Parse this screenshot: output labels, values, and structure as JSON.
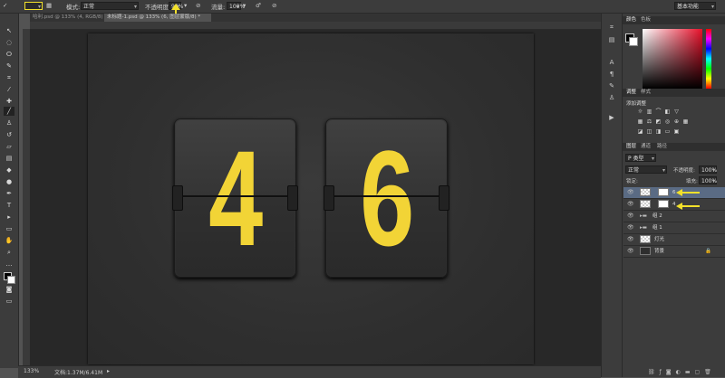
{
  "options_bar": {
    "mode_label": "模式:",
    "mode_value": "正常",
    "opacity_label": "不透明度:",
    "opacity_value": "90%",
    "flow_label": "流量:",
    "flow_value": "100%",
    "workspace": "基本功能"
  },
  "tabs": [
    {
      "label": "哈利.psd @ 133% (4, RGB/8) *"
    },
    {
      "label": "未标题-1.psd @ 133% (6, 图层蒙版/8) *"
    }
  ],
  "canvas": {
    "digit_left": "4",
    "digit_right": "6",
    "digit_color": "#f2d436",
    "highlight_color": "#f3e12a"
  },
  "status": {
    "zoom": "133%",
    "doc_info": "文档:1.37M/6.41M"
  },
  "panels": {
    "color_tabs": [
      "颜色",
      "色板"
    ],
    "adjust_tabs": [
      "调整",
      "样式"
    ],
    "adjust_title": "添加调整",
    "layer_tabs": [
      "图层",
      "通道",
      "路径"
    ],
    "filter_label": "P 类型",
    "blend_mode": "正常",
    "opacity_label": "不透明度:",
    "opacity_value": "100%",
    "lock_label": "锁定:",
    "fill_label": "填充:",
    "fill_value": "100%",
    "layers": [
      {
        "name": "6",
        "selected": true
      },
      {
        "name": "4",
        "selected": false
      },
      {
        "name": "组 2",
        "selected": false
      },
      {
        "name": "组 1",
        "selected": false
      },
      {
        "name": "灯光",
        "selected": false
      },
      {
        "name": "背景",
        "selected": false
      }
    ]
  }
}
